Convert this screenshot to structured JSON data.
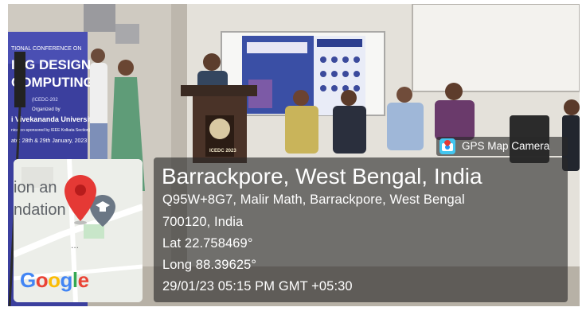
{
  "banner": {
    "line1": "TIONAL CONFERENCE ON",
    "line2": "ING DESIGN",
    "line3": "COMPUTING",
    "line4": "(ICEDC-202",
    "line5": "Organized by",
    "line6": "i Vivekananda University",
    "line7": "nical co-sponsored by IEEE Kolkata Section)",
    "line8": "ate: 28th & 29th January, 2023"
  },
  "podium_emblem": {
    "text": "ICEDC 2023"
  },
  "map": {
    "label_line1": "ion an",
    "label_line2": "ndation",
    "google": [
      "G",
      "o",
      "o",
      "g",
      "l",
      "e"
    ]
  },
  "gps_badge": {
    "label": "GPS Map Camera",
    "icon": "gps-map-camera-icon"
  },
  "location": {
    "title": "Barrackpore, West Bengal, India",
    "address_line1": "Q95W+8G7, Malir Math, Barrackpore, West Bengal",
    "address_line2": "700120, India",
    "lat": "Lat 22.758469°",
    "long": "Long 88.39625°",
    "datetime": "29/01/23 05:15 PM GMT +05:30"
  },
  "colors": {
    "overlay_bg": "rgba(40,40,40,0.62)",
    "map_pin": "#e53935",
    "banner_blue": "#3b3f9e"
  }
}
